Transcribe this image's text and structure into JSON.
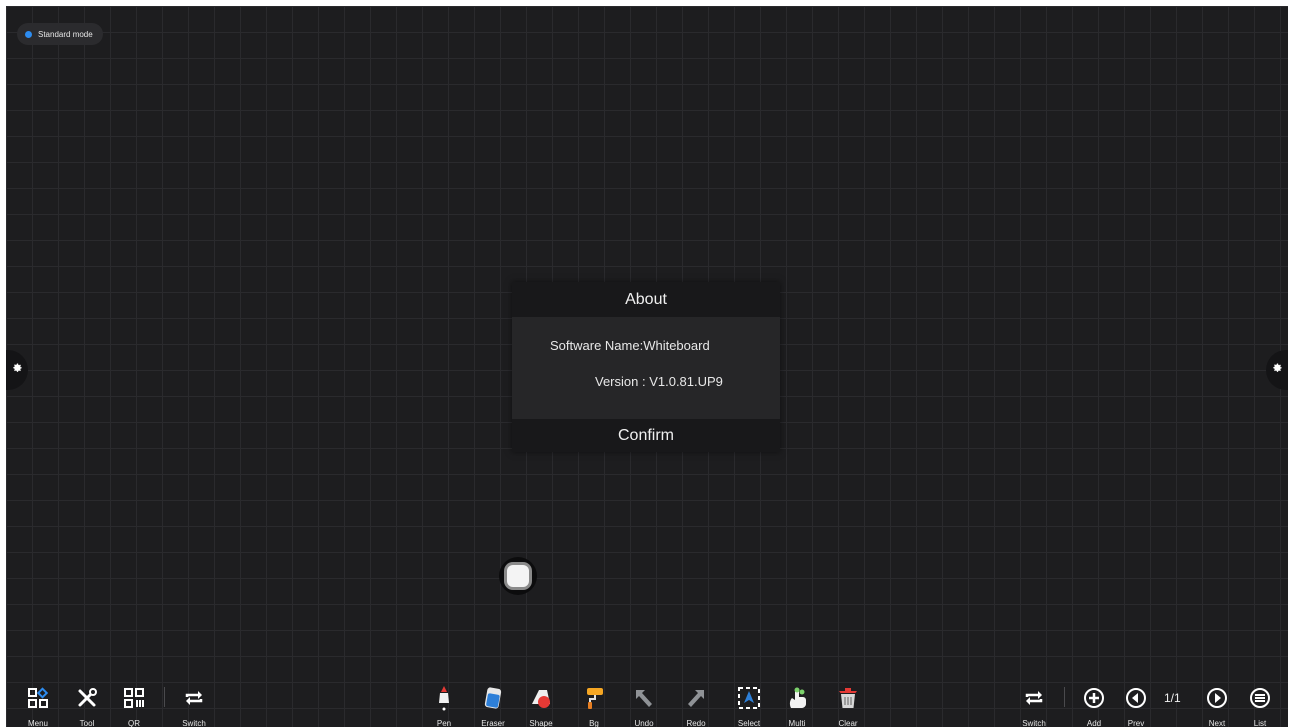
{
  "mode_badge": {
    "label": "Standard mode",
    "dot_color": "#2d8cf0"
  },
  "side_handles": {
    "left_icon": "gear-icon",
    "right_icon": "gear-icon"
  },
  "dialog": {
    "title": "About",
    "software_name": "Software Name:Whiteboard",
    "version": "Version : V1.0.81.UP9",
    "confirm_label": "Confirm"
  },
  "floating_button": {
    "icon": "stop-square-icon"
  },
  "toolbar_left": [
    {
      "label": "Menu",
      "icon": "menu-grid-icon"
    },
    {
      "label": "Tool",
      "icon": "tools-icon"
    },
    {
      "label": "QR",
      "icon": "qr-code-icon"
    },
    {
      "label": "Switch",
      "icon": "switch-icon"
    }
  ],
  "toolbar_center": [
    {
      "label": "Pen",
      "icon": "pen-icon"
    },
    {
      "label": "Eraser",
      "icon": "eraser-icon"
    },
    {
      "label": "Shape",
      "icon": "shape-icon"
    },
    {
      "label": "Bg",
      "icon": "paint-roller-icon"
    },
    {
      "label": "Undo",
      "icon": "undo-icon"
    },
    {
      "label": "Redo",
      "icon": "redo-icon"
    },
    {
      "label": "Select",
      "icon": "select-icon"
    },
    {
      "label": "Multi",
      "icon": "multi-touch-icon"
    },
    {
      "label": "Clear",
      "icon": "trash-icon"
    }
  ],
  "toolbar_right": [
    {
      "label": "Switch",
      "icon": "switch-icon"
    },
    {
      "label": "Add",
      "icon": "add-icon"
    },
    {
      "label": "Prev",
      "icon": "prev-icon"
    },
    {
      "label": "Next",
      "icon": "next-icon"
    },
    {
      "label": "List",
      "icon": "list-icon"
    }
  ],
  "page_indicator": "1/1"
}
